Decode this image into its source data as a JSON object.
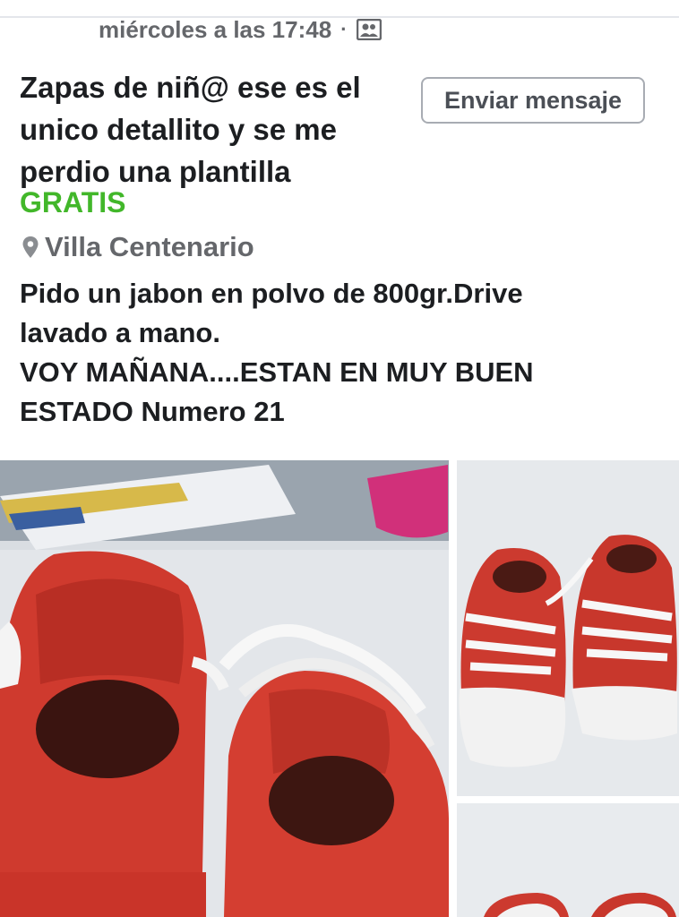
{
  "post": {
    "timestamp": "miércoles a las 17:48",
    "separator": "·",
    "audience_icon": "friends-audience-icon",
    "title": "Zapas de niñ@ ese es el unico detallito y se me perdio una plantilla",
    "price": "GRATIS",
    "location": "Villa Centenario",
    "location_icon": "location-pin-icon",
    "description_lines": [
      "Pido un jabon en polvo de 800gr.Drive",
      "lavado a mano.",
      "VOY MAÑANA....ESTAN EN MUY BUEN",
      "ESTADO Numero 21"
    ]
  },
  "actions": {
    "send_message": "Enviar mensaje"
  },
  "colors": {
    "price_green": "#42b72a",
    "meta_gray": "#65676b",
    "text_dark": "#1c1e21",
    "button_border": "#a8acb3",
    "shoe_red": "#d63a2f"
  }
}
